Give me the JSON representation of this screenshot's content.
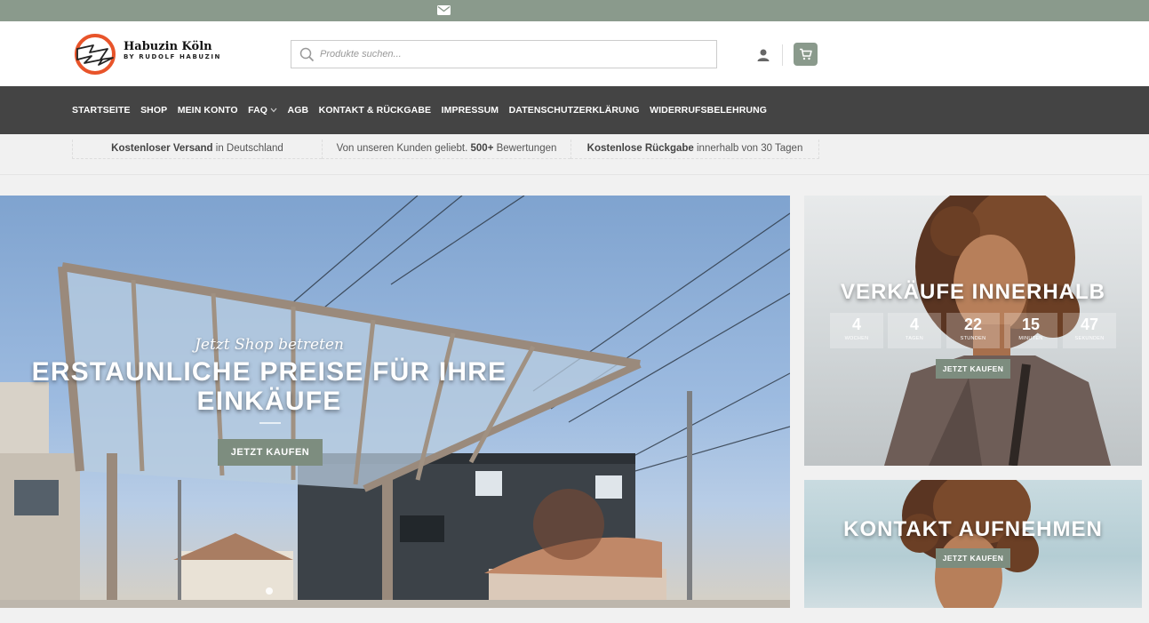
{
  "topbar": {
    "icon": "mail-icon"
  },
  "header": {
    "logo": {
      "title": "Habuzin Köln",
      "subtitle": "BY RUDOLF HABUZIN"
    },
    "search": {
      "placeholder": "Produkte suchen...",
      "value": ""
    },
    "icons": [
      "account-icon",
      "cart-icon"
    ]
  },
  "nav": {
    "items": [
      {
        "label": "STARTSEITE"
      },
      {
        "label": "SHOP"
      },
      {
        "label": "MEIN KONTO"
      },
      {
        "label": "FAQ",
        "has_dropdown": true
      },
      {
        "label": "AGB"
      },
      {
        "label": "KONTAKT & RÜCKGABE"
      },
      {
        "label": "IMPRESSUM"
      },
      {
        "label": "DATENSCHUTZERKLÄRUNG"
      },
      {
        "label": "WIDERRUFSBELEHRUNG"
      }
    ]
  },
  "usp": [
    {
      "bold": "Kostenloser Versand",
      "rest": " in Deutschland"
    },
    {
      "pre": "Von unseren Kunden geliebt. ",
      "bold": "500+",
      "rest": " Bewertungen"
    },
    {
      "bold": "Kostenlose Rückgabe",
      "rest": " innerhalb von 30 Tagen"
    }
  ],
  "hero": {
    "subtitle": "Jetzt Shop betreten",
    "title_line1": "ERSTAUNLICHE PREISE FÜR IHRE",
    "title_line2": "EINKÄUFE",
    "button": "JETZT KAUFEN"
  },
  "sale_banner": {
    "title": "VERKÄUFE INNERHALB",
    "countdown": [
      {
        "value": "4",
        "label": "WOCHEN"
      },
      {
        "value": "4",
        "label": "TAGEN"
      },
      {
        "value": "22",
        "label": "STUNDEN"
      },
      {
        "value": "15",
        "label": "MINUTEN"
      },
      {
        "value": "47",
        "label": "SEKUNDEN"
      }
    ],
    "button": "JETZT KAUFEN"
  },
  "contact_banner": {
    "title": "KONTAKT AUFNEHMEN",
    "button": "JETZT KAUFEN"
  },
  "colors": {
    "accent": "#8a9a8c",
    "nav_bg": "#444444",
    "button": "#7d8d7f"
  }
}
